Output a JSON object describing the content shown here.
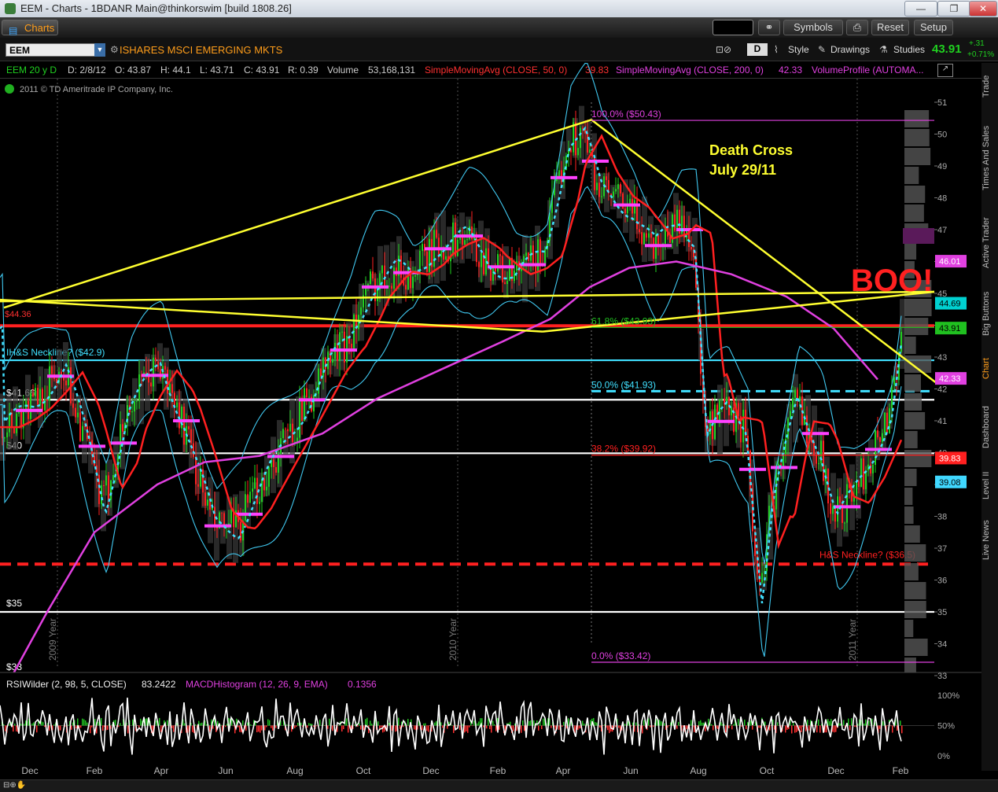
{
  "window": {
    "title": "EEM - Charts - 1BDANR Main@thinkorswim [build 1808.26]",
    "buttons": [
      "—",
      "❐",
      "✕"
    ]
  },
  "toolbar": {
    "tab_label": "Charts",
    "symbols_label": "Symbols",
    "reset_label": "Reset",
    "setup_label": "Setup"
  },
  "symbol_bar": {
    "symbol": "EEM",
    "description": "ISHARES MSCI EMERGING MKTS",
    "period_button": "D",
    "style_label": "Style",
    "drawings_label": "Drawings",
    "studies_label": "Studies",
    "last_price": "43.91",
    "change": "+.31",
    "change_pct": "+0.71%"
  },
  "study_bar": {
    "chart_id": "EEM 20 y D",
    "date": "D: 2/8/12",
    "open": "O: 43.87",
    "high": "H: 44.1",
    "low": "L: 43.71",
    "close": "C: 43.91",
    "range": "R: 0.39",
    "volume_label": "Volume",
    "volume_value": "53,168,131",
    "sma50_label": "SimpleMovingAvg (CLOSE, 50, 0)",
    "sma50_value": "39.83",
    "sma200_label": "SimpleMovingAvg (CLOSE, 200, 0)",
    "sma200_value": "42.33",
    "vp_label": "VolumeProfile (AUTOMA..."
  },
  "copyright": "2011 © TD Ameritrade IP Company, Inc.",
  "colors": {
    "background": "#000000",
    "sma50": "#ff2020",
    "sma200": "#e040e0",
    "bollinger": "#40d8ff",
    "fib": "#e040e0",
    "trend": "#ffff30",
    "volume": "#1a3aa8"
  },
  "chart_data": {
    "type": "line",
    "title": "EEM 20 y D",
    "y_axis": {
      "min": 32.8,
      "max": 51.6,
      "ticks": [
        33,
        34,
        35,
        36,
        37,
        38,
        39,
        40,
        41,
        42,
        43,
        44,
        45,
        46,
        47,
        48,
        49,
        50,
        51
      ],
      "side": "right"
    },
    "x_labels": [
      "Dec",
      "Feb",
      "Apr",
      "Jun",
      "Aug",
      "Oct",
      "Dec",
      "Feb",
      "Apr",
      "Jun",
      "Aug",
      "Oct",
      "Dec",
      "Feb"
    ],
    "year_labels": [
      "2009 Year",
      "2010 Year",
      "2011 Year"
    ],
    "price_tags": [
      {
        "text": "46.01",
        "value": 46.01,
        "color": "#e040e0"
      },
      {
        "text": "44.69",
        "value": 44.69,
        "color": "#00d0d0"
      },
      {
        "text": "43.91",
        "value": 43.91,
        "color": "#20c020"
      },
      {
        "text": "42.33",
        "value": 42.33,
        "color": "#e040e0"
      },
      {
        "text": "39.83",
        "value": 39.83,
        "color": "#ff2020"
      },
      {
        "text": "39.08",
        "value": 39.08,
        "color": "#40d8ff"
      }
    ],
    "horizontal_levels": [
      {
        "value": 43.98,
        "label": "$44.36",
        "color": "#ff2020",
        "style": "solid"
      },
      {
        "value": 42.9,
        "label": "IH&S Neckline? ($42.9)",
        "color": "#40e0ff",
        "style": "solid"
      },
      {
        "value": 41.66,
        "label": "$41.66",
        "color": "#ffffff",
        "style": "solid"
      },
      {
        "value": 39.98,
        "label": "$40",
        "color": "#ffffff",
        "style": "solid"
      },
      {
        "value": 36.5,
        "label": "H&S Neckline? ($36.5)",
        "color": "#ff2020",
        "style": "dashed"
      },
      {
        "value": 35.0,
        "label": "$35",
        "color": "#ffffff",
        "style": "solid"
      },
      {
        "value": 33.0,
        "label": "$33",
        "color": "#ffffff",
        "style": "solid"
      }
    ],
    "fib_levels": [
      {
        "label": "100.0%",
        "value_text": "($50.43)",
        "value": 50.43,
        "color": "#e040e0"
      },
      {
        "label": "61.8%",
        "value_text": "($43.93)",
        "value": 43.93,
        "color": "#20c020"
      },
      {
        "label": "50.0%",
        "value_text": "($41.93)",
        "value": 41.93,
        "color": "#40e0ff"
      },
      {
        "label": "38.2%",
        "value_text": "($39.92)",
        "value": 39.92,
        "color": "#ff2020"
      },
      {
        "label": "0.0%",
        "value_text": "($33.42)",
        "value": 33.42,
        "color": "#e040e0"
      }
    ],
    "annotations": {
      "death_cross": [
        "Death Cross",
        "July 29/11"
      ],
      "boo": "BOO!"
    },
    "lower_panel": {
      "rsi_label": "RSIWilder (2, 98, 5, CLOSE)",
      "rsi_value": "83.2422",
      "macd_label": "MACDHistogram (12, 26, 9, EMA)",
      "macd_value": "0.1356",
      "ticks": [
        "100%",
        "50%",
        "0%"
      ]
    }
  }
}
